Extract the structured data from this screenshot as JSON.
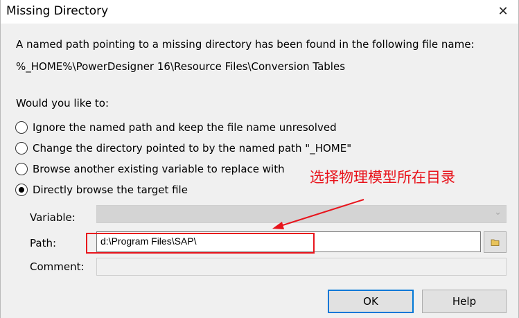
{
  "window": {
    "title": "Missing Directory",
    "close_label": "✕"
  },
  "message": {
    "line1": "A named path pointing to a missing directory has been found in the following file name:",
    "path": "%_HOME%\\PowerDesigner 16\\Resource Files\\Conversion Tables"
  },
  "question": "Would you like to:",
  "options": [
    {
      "label": "Ignore the named path and keep the file name unresolved",
      "checked": false
    },
    {
      "label": "Change the directory pointed to by the named path \"_HOME\"",
      "checked": false
    },
    {
      "label": "Browse another existing variable to replace with",
      "checked": false
    },
    {
      "label": "Directly browse the target file",
      "checked": true
    }
  ],
  "fields": {
    "variable_label": "Variable:",
    "variable_value": "",
    "path_label": "Path:",
    "path_value": "d:\\Program Files\\SAP\\",
    "comment_label": "Comment:",
    "comment_value": ""
  },
  "buttons": {
    "ok": "OK",
    "help": "Help"
  },
  "annotation": {
    "text": "选择物理模型所在目录",
    "color": "#e8141c"
  },
  "icons": {
    "close": "close-icon",
    "dropdown": "chevron-down-icon",
    "browse": "folder-icon"
  }
}
